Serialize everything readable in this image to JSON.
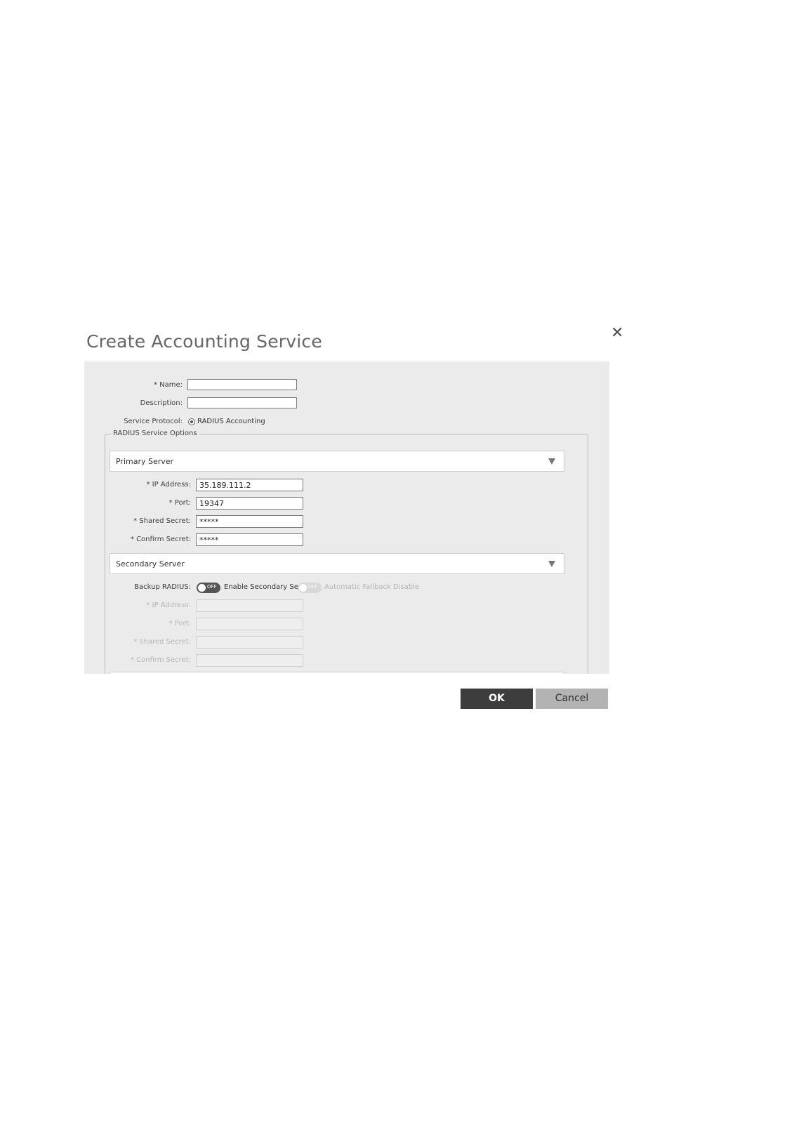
{
  "dialog": {
    "title": "Create Accounting Service",
    "close_icon": "close-icon"
  },
  "form": {
    "name_label": "* Name:",
    "name_value": "",
    "description_label": "Description:",
    "description_value": "",
    "service_protocol_label": "Service Protocol:",
    "service_protocol_option": "RADIUS Accounting"
  },
  "radius_options": {
    "legend": "RADIUS Service Options",
    "primary": {
      "header": "Primary Server",
      "ip_label": "* IP Address:",
      "ip_value": "35.189.111.2",
      "port_label": "* Port:",
      "port_value": "19347",
      "secret_label": "* Shared Secret:",
      "secret_value": "*****",
      "confirm_label": "* Confirm Secret:",
      "confirm_value": "*****"
    },
    "secondary": {
      "header": "Secondary Server",
      "backup_label": "Backup RADIUS:",
      "toggle_state": "OFF",
      "enable_text": "Enable Secondary Server",
      "fallback_toggle_state": "OFF",
      "fallback_text": "Automatic Fallback Disable",
      "ip_label": "* IP Address:",
      "port_label": "* Port:",
      "secret_label": "* Shared Secret:",
      "confirm_label": "* Confirm Secret:"
    }
  },
  "buttons": {
    "ok": "OK",
    "cancel": "Cancel"
  }
}
